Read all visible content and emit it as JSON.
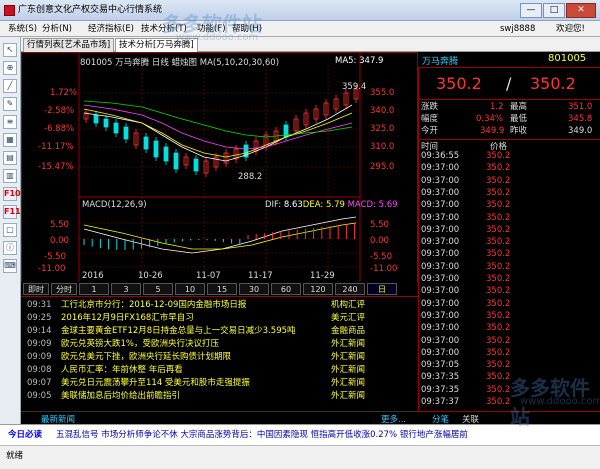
{
  "window": {
    "title": "广东创意文化产权交易中心行情系统",
    "min": "—",
    "max": "□",
    "close": "✕"
  },
  "menu": {
    "items": [
      "系统(S)",
      "分析(N)",
      "经济指标(E)",
      "技术分析(T)",
      "功能(F)",
      "帮助(H)"
    ],
    "user": "swj8888",
    "welcome": "欢迎您!"
  },
  "tabs": [
    "行情列表[艺术品市场]",
    "技术分析[万马奔腾]"
  ],
  "toolbar_icons": [
    "cursor-icon",
    "zoom-icon",
    "line-icon",
    "pen-icon",
    "list-icon",
    "grid-icon",
    "chart-icon",
    "chart-icon",
    "chart-icon",
    "F10-icon",
    "F11-icon",
    "doc-icon",
    "info-icon",
    "keyboard-icon"
  ],
  "toolbar_labels": [
    "F10",
    "F11"
  ],
  "chart": {
    "header": "801005 万马奔腾 日线  蜡烛图 MA(5,10,20,30,60)",
    "ma5_label": "MA5: 347.9",
    "left_pct": [
      "1.72%",
      "-2.58%",
      "-6.88%",
      "-11.17%",
      "-15.47%"
    ],
    "right_prices": [
      "355.0",
      "340.0",
      "325.0",
      "310.0",
      "295.0"
    ],
    "annot_high": "359.4",
    "annot_low": "288.2",
    "macd_label": "MACD(12,26,9)",
    "dif_label": "DIF: ",
    "dif_value": "8.63",
    "dea_label": "DEA: ",
    "dea_value": "5.79",
    "macd_name": "MACD: ",
    "macd_value": "5.69",
    "macd_left": [
      "5.50",
      "0.00",
      "-5.50",
      "-11.00"
    ],
    "macd_right": [
      "5.50",
      "0.00",
      "-5.50",
      "-11.00"
    ],
    "dates": [
      "2016",
      "10-26",
      "11-07",
      "11-17",
      "11-29"
    ],
    "bottom_tabs": [
      "即时",
      "分时",
      "1",
      "3",
      "5",
      "10",
      "15",
      "30",
      "60",
      "120",
      "240",
      "日"
    ]
  },
  "news": {
    "rows": [
      {
        "time": "09:31",
        "headline": "工行北京市分行：2016-12-09国内金融市场日报",
        "source": "机构汇评"
      },
      {
        "time": "09:25",
        "headline": "2016年12月9日FX168汇市早自习",
        "source": "美元汇评"
      },
      {
        "time": "09:14",
        "headline": "金球主要黄金ETF12月8日持金总量与上一交易日减少3.595吨",
        "source": "金融商品"
      },
      {
        "time": "09:09",
        "headline": "欧元兑英镑大跌1%，受欧洲央行决议打压",
        "source": "外汇新闻"
      },
      {
        "time": "09:09",
        "headline": "欧元兑美元下挫，欧洲央行延长购债计划期限",
        "source": "外汇新闻"
      },
      {
        "time": "09:08",
        "headline": "人民币汇率：年前休整 年后再看",
        "source": "外汇新闻"
      },
      {
        "time": "09:07",
        "headline": "美元兑日元震荡攀升至114 受美元和股市走强提振",
        "source": "外汇新闻"
      },
      {
        "time": "09:05",
        "headline": "美联储加息后均价给出前瞻指引",
        "source": "外汇新闻"
      }
    ],
    "footer_left": "最新新闻",
    "footer_right": "更多..."
  },
  "quote": {
    "name": "万马奔腾",
    "code": "801005",
    "bid": "350.2",
    "sep": "/",
    "ask": "350.2",
    "rows": [
      {
        "l": "涨跌",
        "v": "1.2",
        "l2": "最高",
        "v2": "351.0"
      },
      {
        "l": "幅度",
        "v": "0.34%",
        "l2": "最低",
        "v2": "345.8"
      },
      {
        "l": "今开",
        "v": "349.9",
        "l2": "昨收",
        "v2": "349.0"
      }
    ],
    "col_time": "时间",
    "col_price": "价格",
    "ticks": [
      {
        "t": "09:36:55",
        "p": "350.2"
      },
      {
        "t": "09:37:00",
        "p": "350.2"
      },
      {
        "t": "09:37:00",
        "p": "350.2"
      },
      {
        "t": "09:37:00",
        "p": "350.2"
      },
      {
        "t": "09:37:00",
        "p": "350.2"
      },
      {
        "t": "09:37:00",
        "p": "350.2"
      },
      {
        "t": "09:37:00",
        "p": "350.2"
      },
      {
        "t": "09:37:00",
        "p": "350.2"
      },
      {
        "t": "09:37:00",
        "p": "350.2"
      },
      {
        "t": "09:37:00",
        "p": "350.2"
      },
      {
        "t": "09:37:00",
        "p": "350.2"
      },
      {
        "t": "09:37:00",
        "p": "350.2"
      },
      {
        "t": "09:37:00",
        "p": "350.2"
      },
      {
        "t": "09:37:00",
        "p": "350.2"
      },
      {
        "t": "09:37:00",
        "p": "350.2"
      },
      {
        "t": "09:37:00",
        "p": "350.2"
      },
      {
        "t": "09:37:00",
        "p": "350.2"
      },
      {
        "t": "09:37:05",
        "p": "350.2"
      },
      {
        "t": "09:37:35",
        "p": "350.2"
      },
      {
        "t": "09:37:35",
        "p": "350.2"
      },
      {
        "t": "09:37:37",
        "p": "350.2"
      }
    ],
    "tabs": [
      "分笔",
      "关联"
    ]
  },
  "marquee": {
    "label": "今日必读",
    "text": "五混乱信号 市场分析师争论不休  大宗商品涨势背后：中国因素隐现  恒指高开低收涨0.27% 银行地产涨幅居前"
  },
  "status": "就绪",
  "watermark": {
    "title": "多多软件站",
    "url": "www.ddooo.com"
  },
  "colors": {
    "up": "#ff3333",
    "down": "#00e0e0",
    "grid": "#8a0000",
    "yellow": "#ffff33",
    "cyan": "#00e0e0"
  }
}
